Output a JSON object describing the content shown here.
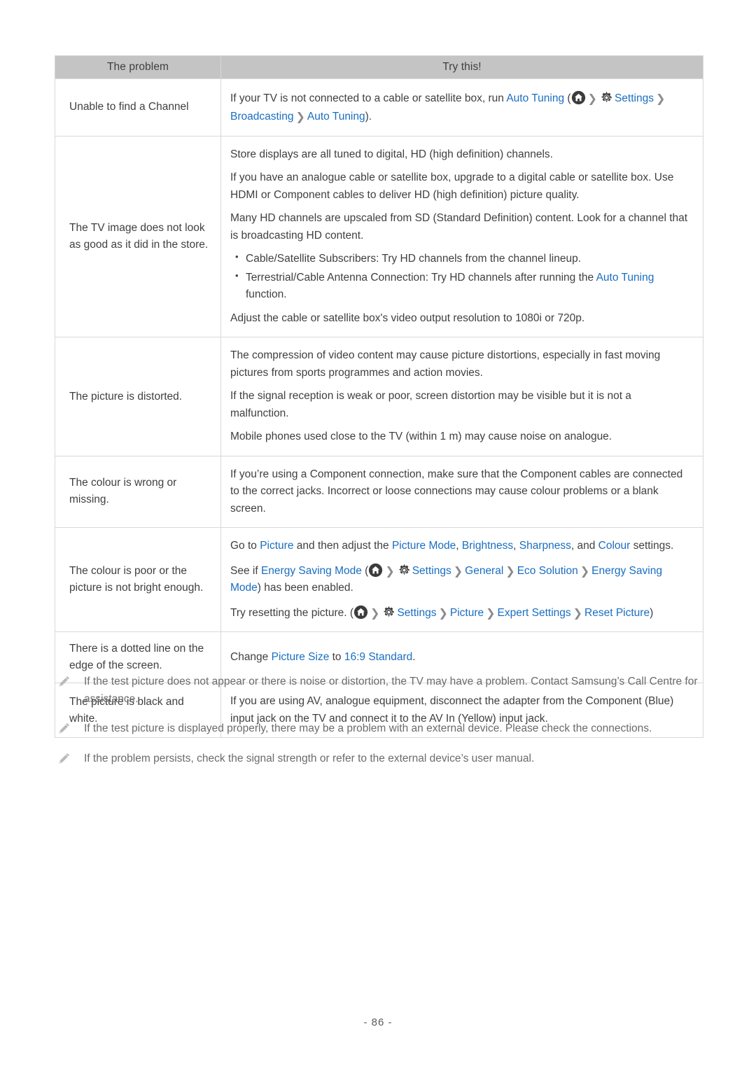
{
  "document": {
    "page_number": "- 86 -"
  },
  "table": {
    "headers": {
      "problem": "The problem",
      "try_this": "Try this!"
    },
    "rows": [
      {
        "problem": "Unable to find a Channel",
        "answer_parts": {
          "p1_a": "If your TV is not connected to a cable or satellite box, run ",
          "p1_link1": "Auto Tuning",
          "p1_open": " (",
          "p1_link2": "Settings",
          "p1_link3": "Broadcasting",
          "p1_link4": "Auto Tuning",
          "p1_close": ")."
        }
      },
      {
        "problem": "The TV image does not look as good as it did in the store.",
        "answer_parts": {
          "p1": "Store displays are all tuned to digital, HD (high definition) channels.",
          "p2": "If you have an analogue cable or satellite box, upgrade to a digital cable or satellite box. Use HDMI or Component cables to deliver HD (high definition) picture quality.",
          "p3": "Many HD channels are upscaled from SD (Standard Definition) content. Look for a channel that is broadcasting HD content.",
          "bullet1": "Cable/Satellite Subscribers: Try HD channels from the channel lineup.",
          "bullet2_a": "Terrestrial/Cable Antenna Connection: Try HD channels after running the ",
          "bullet2_link": "Auto Tuning",
          "bullet2_b": " function.",
          "p4": "Adjust the cable or satellite box's video output resolution to 1080i or 720p."
        }
      },
      {
        "problem": "The picture is distorted.",
        "answer_parts": {
          "p1": "The compression of video content may cause picture distortions, especially in fast moving pictures from sports programmes and action movies.",
          "p2": "If the signal reception is weak or poor, screen distortion may be visible but it is not a malfunction.",
          "p3": "Mobile phones used close to the TV (within 1 m) may cause noise on analogue."
        }
      },
      {
        "problem": "The colour is wrong or missing.",
        "answer_parts": {
          "p1": "If you’re using a Component connection, make sure that the Component cables are connected to the correct jacks. Incorrect or loose connections may cause colour problems or a blank screen."
        }
      },
      {
        "problem": "The colour is poor or the picture is not bright enough.",
        "answer_parts": {
          "p1_a": "Go to ",
          "p1_link1": "Picture",
          "p1_b": " and then adjust the ",
          "p1_link2": "Picture Mode",
          "p1_c": ", ",
          "p1_link3": "Brightness",
          "p1_d": ", ",
          "p1_link4": "Sharpness",
          "p1_e": ", and ",
          "p1_link5": "Colour",
          "p1_f": " settings.",
          "p2_a": "See if ",
          "p2_link1": "Energy Saving Mode",
          "p2_open": " (",
          "p2_link2": "Settings",
          "p2_link3": "General",
          "p2_link4": "Eco Solution",
          "p2_link5": "Energy Saving Mode",
          "p2_close": ") has been enabled.",
          "p3_a": "Try resetting the picture. (",
          "p3_link1": "Settings",
          "p3_link2": "Picture",
          "p3_link3": "Expert Settings",
          "p3_link4": "Reset Picture",
          "p3_close": ")"
        }
      },
      {
        "problem": "There is a dotted line on the edge of the screen.",
        "answer_parts": {
          "p1_a": "Change ",
          "p1_link1": "Picture Size",
          "p1_b": " to ",
          "p1_link2": "16:9 Standard",
          "p1_c": "."
        }
      },
      {
        "problem": "The picture is black and white.",
        "answer_parts": {
          "p1": "If you are using AV, analogue equipment, disconnect the adapter from the Component (Blue) input jack on the TV and connect it to the AV In (Yellow) input jack."
        }
      }
    ]
  },
  "notes": [
    {
      "icon": "pencil-icon",
      "text": "If the test picture does not appear or there is noise or distortion, the TV may have a problem. Contact Samsung’s Call Centre for assistance."
    },
    {
      "icon": "pencil-icon",
      "text": "If the test picture is displayed properly, there may be a problem with an external device. Please check the connections."
    },
    {
      "icon": "pencil-icon",
      "text": "If the problem persists, check the signal strength or refer to the external device’s user manual."
    }
  ],
  "icons": {
    "home": "home-icon",
    "gear": "gear-icon",
    "chevron": "chevron-right-icon",
    "pencil": "pencil-icon"
  },
  "colors": {
    "link": "#1a6ec0",
    "header_bg": "#c4c4c4",
    "border": "#d8d8d8",
    "text": "#3f3f3f",
    "note_text": "#6b6b6b",
    "icon_dark": "#3c3c3c",
    "icon_grey": "#b0b0b0"
  },
  "separators": {
    "chevron": "❯"
  }
}
